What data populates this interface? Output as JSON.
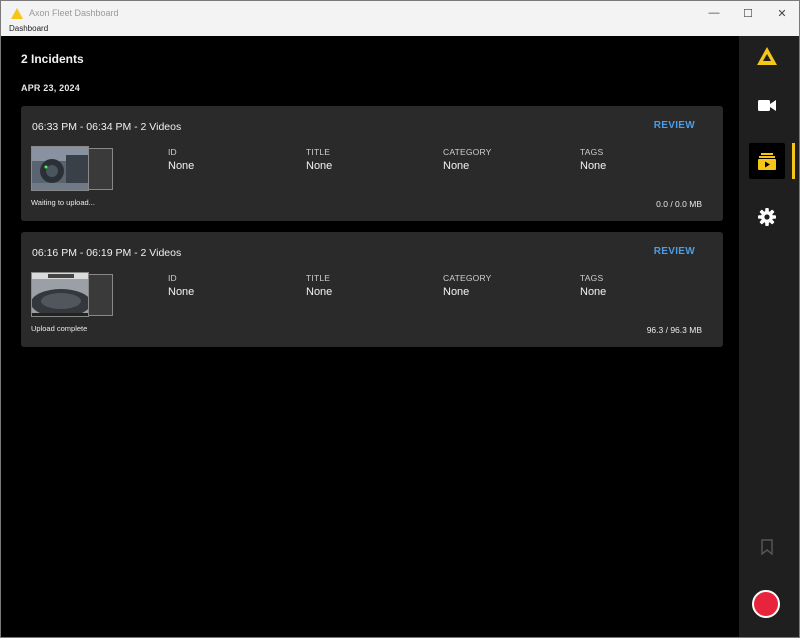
{
  "window": {
    "title": "Axon Fleet Dashboard",
    "controls": {
      "minimize": "—",
      "maximize": "☐",
      "close": "✕"
    }
  },
  "menu": {
    "label": "Dashboard"
  },
  "main": {
    "incident_count": "2 Incidents",
    "date": "APR 23, 2024",
    "columns": {
      "id": "ID",
      "title": "TITLE",
      "category": "CATEGORY",
      "tags": "TAGS"
    },
    "review_label": "REVIEW",
    "incidents": [
      {
        "time_range": "06:33 PM - 06:34 PM - 2 Videos",
        "id": "None",
        "title": "None",
        "category": "None",
        "tags": "None",
        "status": "Waiting to upload...",
        "size": "0.0 / 0.0 MB"
      },
      {
        "time_range": "06:16 PM - 06:19 PM - 2 Videos",
        "id": "None",
        "title": "None",
        "category": "None",
        "tags": "None",
        "status": "Upload complete",
        "size": "96.3 / 96.3 MB"
      }
    ]
  },
  "sidebar": {
    "items": [
      {
        "icon": "axon-logo-icon"
      },
      {
        "icon": "video-camera-icon"
      },
      {
        "icon": "incidents-icon",
        "active": true
      },
      {
        "icon": "gear-icon"
      },
      {
        "icon": "bookmark-icon"
      },
      {
        "icon": "record-icon"
      }
    ]
  },
  "colors": {
    "accent": "#4a9de8",
    "brand": "#f5c518",
    "record": "#e8243c",
    "card": "#2a2a2a"
  }
}
